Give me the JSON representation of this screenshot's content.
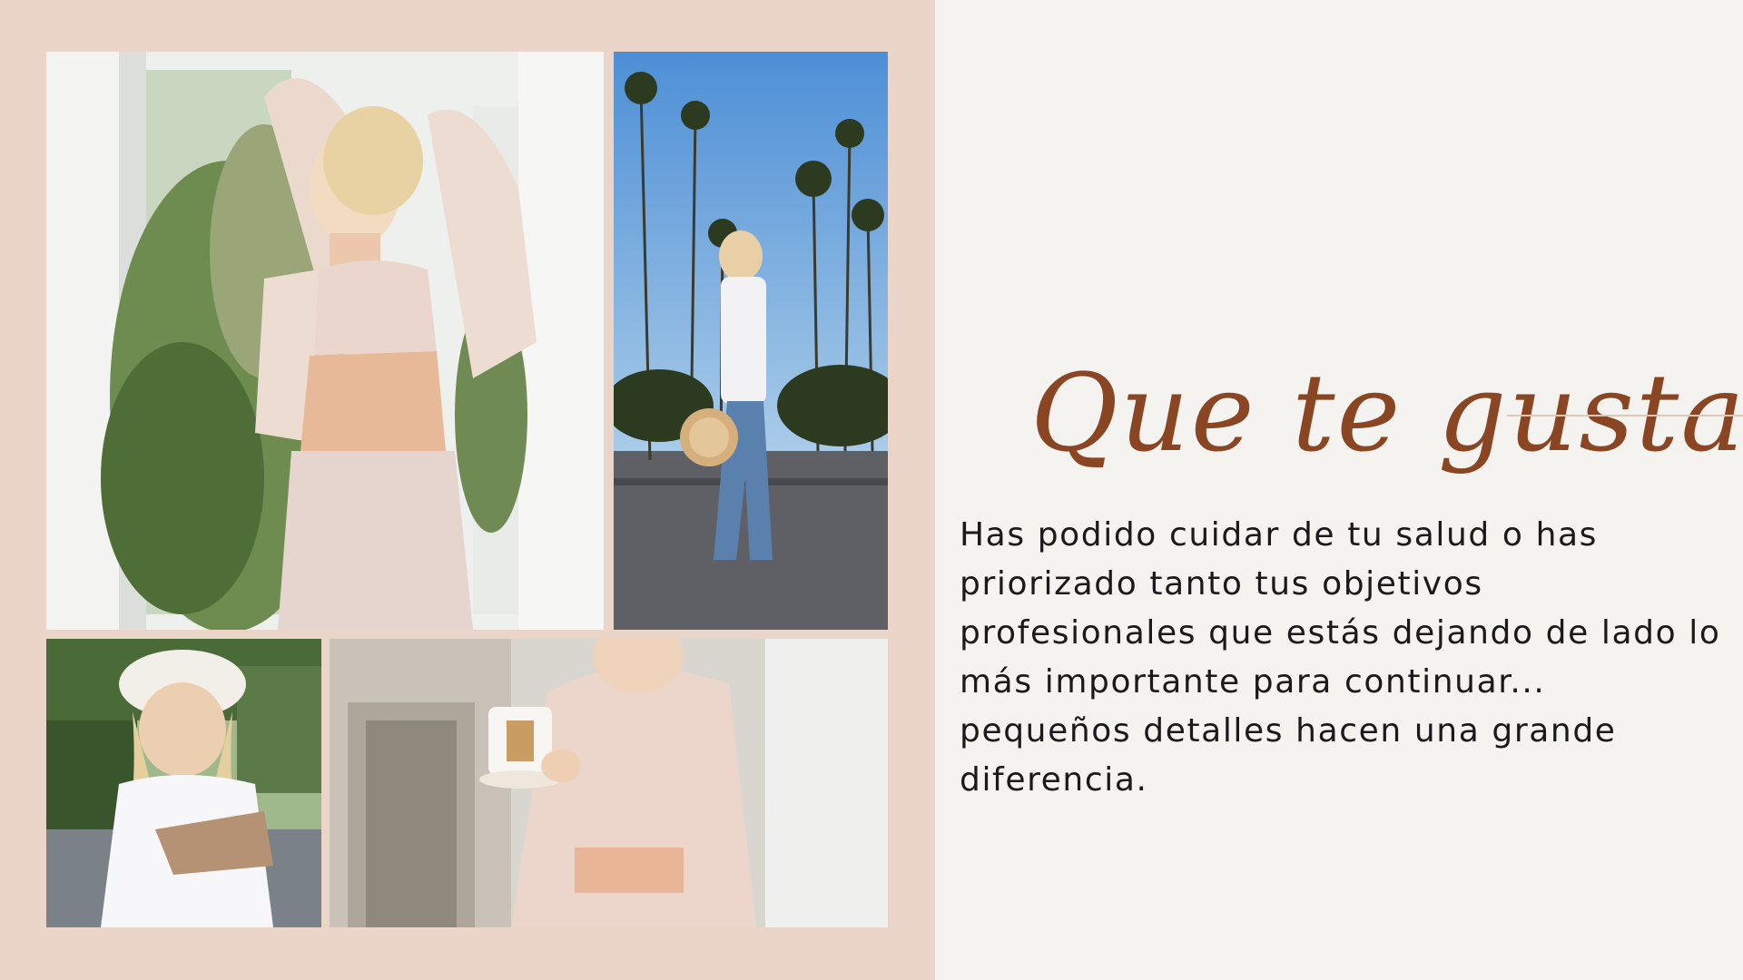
{
  "heading": "Que te gusta?",
  "body": "Has podido cuidar de tu salud o has priorizado tanto tus objetivos profesionales que estás dejando de lado lo más importante para continuar... pequeños detalles hacen una grande diferencia.",
  "colors": {
    "left_panel": "#ead5c8",
    "background": "#f5f3f0",
    "heading": "#8a4523",
    "body_text": "#1a1a1a",
    "accent_line": "#e2c6b5"
  },
  "photos": [
    {
      "name": "photo-window"
    },
    {
      "name": "photo-palms"
    },
    {
      "name": "photo-hat"
    },
    {
      "name": "photo-mug"
    }
  ]
}
